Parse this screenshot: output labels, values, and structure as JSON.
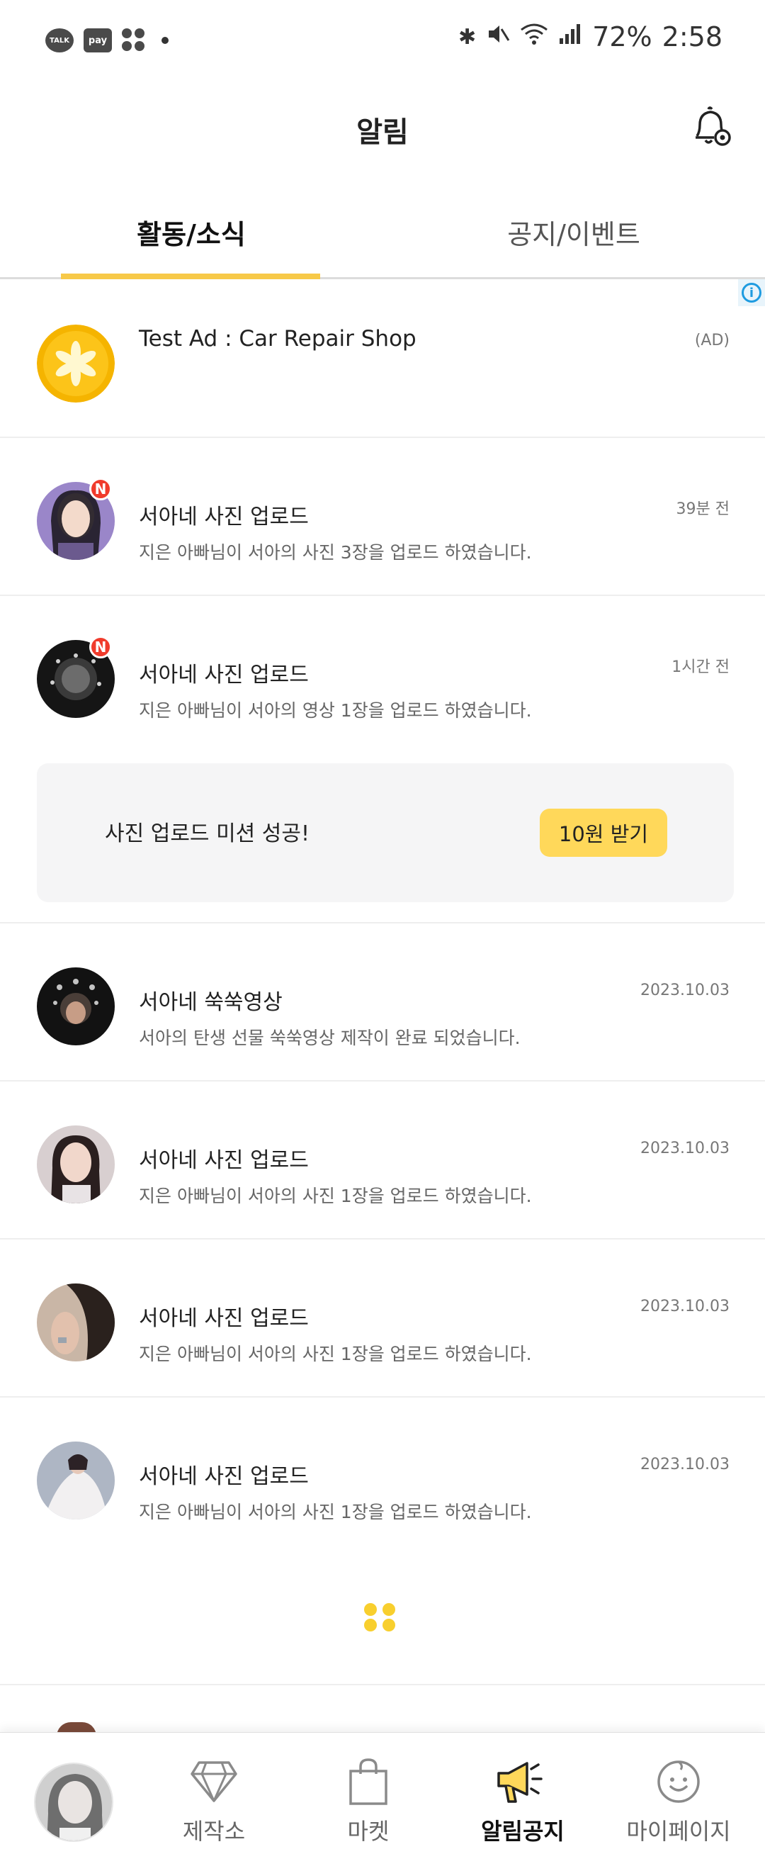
{
  "status_bar": {
    "talk_label": "TALK",
    "pay_label": "pay",
    "battery": "72%",
    "time": "2:58"
  },
  "header": {
    "title": "알림",
    "settings_icon": "bell-gear-icon"
  },
  "tabs": [
    {
      "label": "활동/소식",
      "active": true
    },
    {
      "label": "공지/이벤트",
      "active": false
    }
  ],
  "ad": {
    "title": "Test Ad : Car Repair Shop",
    "label": "(AD)",
    "info_glyph": "i"
  },
  "notifications": [
    {
      "title": "서아네 사진 업로드",
      "desc": "지은 아빠님이 서아의 사진 3장을 업로드 하였습니다.",
      "time": "39분 전",
      "badge": "N"
    },
    {
      "title": "서아네 사진 업로드",
      "desc": "지은 아빠님이 서아의 영상 1장을 업로드 하였습니다.",
      "time": "1시간 전",
      "badge": "N"
    },
    {
      "title": "서아네 쑥쑥영상",
      "desc": "서아의 탄생 선물 쑥쑥영상 제작이 완료 되었습니다.",
      "time": "2023.10.03"
    },
    {
      "title": "서아네 사진 업로드",
      "desc": "지은 아빠님이 서아의 사진 1장을 업로드 하였습니다.",
      "time": "2023.10.03"
    },
    {
      "title": "서아네 사진 업로드",
      "desc": "지은 아빠님이 서아의 사진 1장을 업로드 하였습니다.",
      "time": "2023.10.03"
    },
    {
      "title": "서아네 사진 업로드",
      "desc": "지은 아빠님이 서아의 사진 1장을 업로드 하였습니다.",
      "time": "2023.10.03"
    }
  ],
  "mission": {
    "text": "사진 업로드 미션 성공!",
    "button": "10원 받기"
  },
  "bottom_nav": [
    {
      "label": "제작소",
      "icon": "diamond-icon"
    },
    {
      "label": "마켓",
      "icon": "shopping-bag-icon"
    },
    {
      "label": "알림공지",
      "icon": "megaphone-icon",
      "active": true
    },
    {
      "label": "마이페이지",
      "icon": "smiley-face-icon"
    }
  ],
  "colors": {
    "accent": "#f7c948",
    "button_yellow": "#ffd85a",
    "badge_red": "#f03b2c",
    "info_blue": "#1e9be0"
  }
}
